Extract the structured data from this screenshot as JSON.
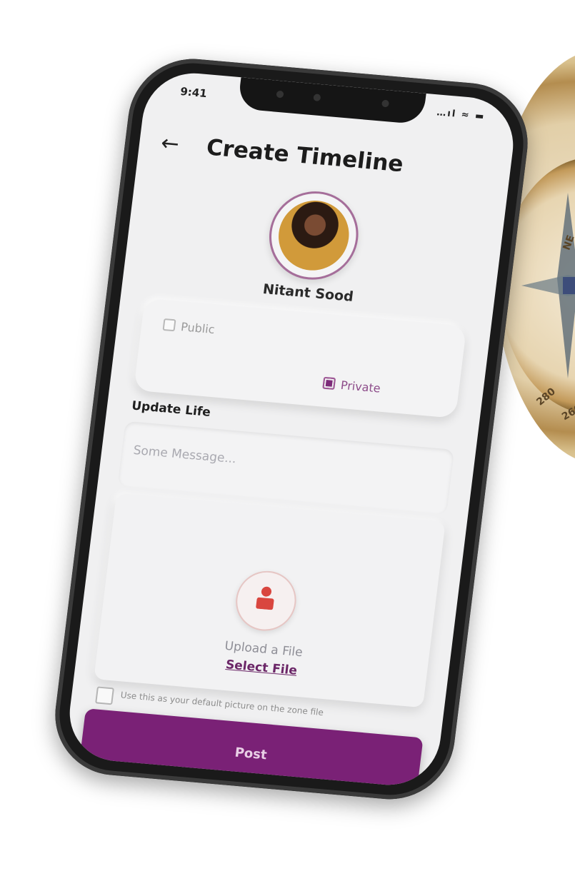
{
  "status_bar": {
    "time": "9:41",
    "icons": "…ıl ≈ ▬"
  },
  "header": {
    "back_icon": "←",
    "title": "Create Timeline"
  },
  "profile": {
    "name": "Nitant Sood"
  },
  "visibility": {
    "options": [
      {
        "label": "Public",
        "selected": false
      },
      {
        "label": "Private",
        "selected": true
      }
    ]
  },
  "update_life": {
    "label": "Update Life",
    "message_placeholder": "Some Message..."
  },
  "upload": {
    "text": "Upload a File",
    "link": "Select File"
  },
  "default_option": {
    "text": "Use this as your default picture on the zone file",
    "checked": false
  },
  "post_button": {
    "label": "Post"
  },
  "colors": {
    "accent": "#7a2176",
    "screen_bg": "#f0f0f1",
    "phone_frame": "#1a1a1a"
  }
}
